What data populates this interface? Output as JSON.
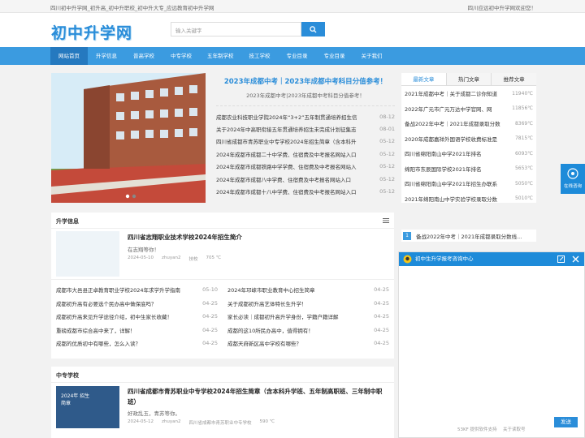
{
  "topbar": {
    "left": "四川初中升学网_初升高_初中升职校_初中升大专_应远教育初中升学网",
    "right": "四川应远初中升学网欢迎您！"
  },
  "logo": "初中升学网",
  "search": {
    "placeholder": "输入关键字"
  },
  "nav": [
    "网站首页",
    "升学信息",
    "普高学校",
    "中专学校",
    "五年制学校",
    "技工学校",
    "专业目录",
    "专业目录",
    "关于我们"
  ],
  "top_news": {
    "title": "2023年成都中考｜2023年成都中考科目分值参考！",
    "subtitle": "2023年成都中考|2023年成都中考科目分值参考！",
    "items": [
      {
        "t": "成都农业科技职业学院2024年“3+2”五年制贯通培养招生信",
        "d": "08-12"
      },
      {
        "t": "关于2024年中高职衔接五年贯通培养招生未完成计划征集志",
        "d": "08-01"
      },
      {
        "t": "四川省成都市青苏职业中专学校2024年招生简章（含本科升",
        "d": "05-12"
      },
      {
        "t": "2024年成都市成都二十中学费、住宿费及中考报名网站入口",
        "d": "05-12"
      },
      {
        "t": "2024年成都市成都铁路中学学费、住宿费及中考报名网站入",
        "d": "05-12"
      },
      {
        "t": "2024年成都市成都八中学费、住宿费及中考报名网站入口",
        "d": "05-12"
      },
      {
        "t": "2024年成都市成都十八中学费、住宿费及中考报名网站入口",
        "d": "05-12"
      }
    ]
  },
  "tabs": {
    "labels": [
      "最新文章",
      "热门文章",
      "推荐文章"
    ],
    "items": [
      {
        "t": "2021年成都中考｜关于成都二诊你知道",
        "v": "11940℃"
      },
      {
        "t": "2022年广元市广元万达中学官网、网",
        "v": "11856℃"
      },
      {
        "t": "备战2022年中考｜2021年成都录取分数",
        "v": "8369℃"
      },
      {
        "t": "2020年成都嘉祥外国语学校收费标准是",
        "v": "7815℃"
      },
      {
        "t": "四川省绵阳南山中学2021年排名",
        "v": "6093℃"
      },
      {
        "t": "绵阳市东辰国际学校2021年排名",
        "v": "5653℃"
      },
      {
        "t": "四川省绵阳南山中学2021年招生办联系",
        "v": "5050℃"
      },
      {
        "t": "2021年绵阳南山中学实验学校录取分数",
        "v": "5010℃"
      }
    ]
  },
  "sec1": {
    "title": "升学信息",
    "feature": {
      "title": "四川省志翔职业技术学校2024年招生简介",
      "desc": "在志翔等你！",
      "date": "2024-05-10",
      "author": "zhuyan2",
      "tag": "技校",
      "views": "705 ℃"
    },
    "left": [
      {
        "t": "成都市大邑县正卓教育职业学校2024年求学升学指南",
        "d": "05-10"
      },
      {
        "t": "成都初升高有必要选个民办高中做保底吗？",
        "d": "04-25"
      },
      {
        "t": "成都初升高来见升学途径介绍，初中生家长收藏！",
        "d": "04-25"
      },
      {
        "t": "重磅成都市综合高中来了，详解！",
        "d": "04-25"
      },
      {
        "t": "成都的优质初中有哪些，怎么入读？",
        "d": "04-25"
      }
    ],
    "right": [
      {
        "t": "2024年邛崃市职业教育中心招生简章",
        "d": "04-25"
      },
      {
        "t": "关于成都初升高艺体特长生升学！",
        "d": "04-25"
      },
      {
        "t": "家长必读｜成都初升高升学身份，学籍户籍详解",
        "d": "04-25"
      },
      {
        "t": "成都的这10所民办高中，值得拥有！",
        "d": "04-25"
      },
      {
        "t": "成都天府新区高中学校有哪些？",
        "d": "04-25"
      }
    ]
  },
  "sec2": {
    "title": "中专学校",
    "feature": {
      "title": "四川省成都市青苏职业中专学校2024年招生简章（含本科升学班、五年制高职班、三年制中职班）",
      "desc": "好政乱玉，青苏等你。",
      "date": "2024-05-12",
      "author": "zhuyan2",
      "tag": "四川省成都市青苏职业中专学校",
      "views": "590 ℃"
    },
    "img_text": "2024年 招生简章"
  },
  "side2": [
    {
      "n": "1",
      "t": "备战2022年中考｜2021年成都录取分数线..."
    }
  ],
  "chat": {
    "title": "初中生升学报考咨询中心",
    "send": "发送",
    "footer": "53KF 提供软件支持",
    "footer2": "关于读取号"
  },
  "consult": "在线咨询"
}
